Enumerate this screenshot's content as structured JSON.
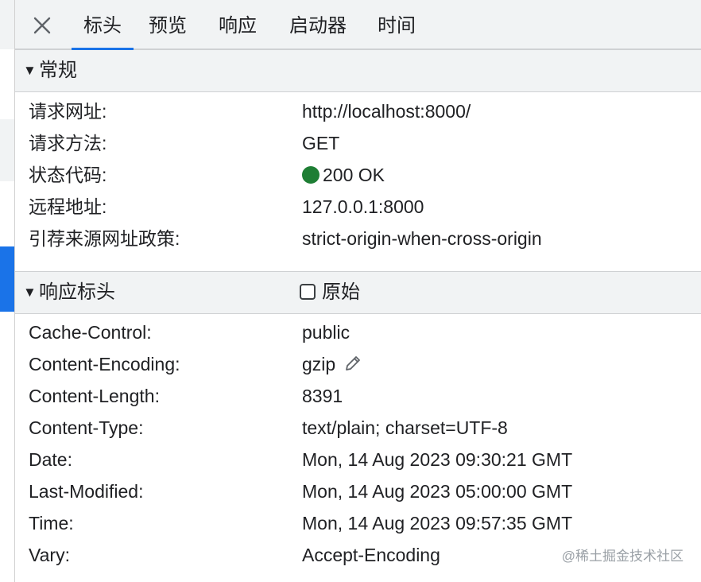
{
  "tabs": [
    {
      "label": "标头",
      "active": true
    },
    {
      "label": "预览",
      "active": false
    },
    {
      "label": "响应",
      "active": false
    },
    {
      "label": "启动器",
      "active": false
    },
    {
      "label": "时间",
      "active": false
    }
  ],
  "general": {
    "title": "常规",
    "rows": [
      {
        "key": "请求网址:",
        "value": "http://localhost:8000/"
      },
      {
        "key": "请求方法:",
        "value": "GET"
      },
      {
        "key": "状态代码:",
        "value": "200 OK"
      },
      {
        "key": "远程地址:",
        "value": "127.0.0.1:8000"
      },
      {
        "key": "引荐来源网址政策:",
        "value": "strict-origin-when-cross-origin"
      }
    ]
  },
  "response_headers": {
    "title": "响应标头",
    "raw_label": "原始",
    "raw_checked": false,
    "rows": [
      {
        "key": "Cache-Control:",
        "value": "public"
      },
      {
        "key": "Content-Encoding:",
        "value": "gzip"
      },
      {
        "key": "Content-Length:",
        "value": "8391"
      },
      {
        "key": "Content-Type:",
        "value": "text/plain; charset=UTF-8"
      },
      {
        "key": "Date:",
        "value": "Mon, 14 Aug 2023 09:30:21 GMT"
      },
      {
        "key": "Last-Modified:",
        "value": "Mon, 14 Aug 2023 05:00:00 GMT"
      },
      {
        "key": "Time:",
        "value": "Mon, 14 Aug 2023 09:57:35 GMT"
      },
      {
        "key": "Vary:",
        "value": "Accept-Encoding"
      }
    ]
  },
  "status_color": "#1e7e34",
  "accent_color": "#1a73e8",
  "watermark": "@稀土掘金技术社区"
}
